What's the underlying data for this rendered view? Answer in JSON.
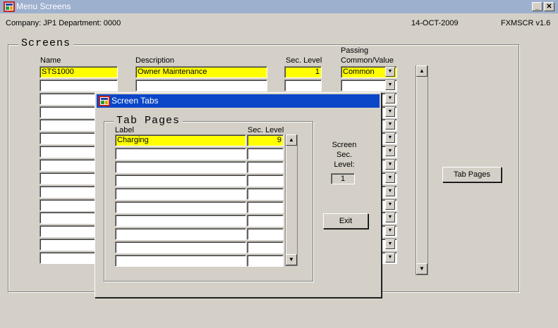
{
  "window": {
    "title": "Menu Screens",
    "minimize_glyph": "_",
    "close_glyph": "✕"
  },
  "info": {
    "company": "Company: JP1   Department: 0000",
    "date": "14-OCT-2009",
    "form": "FXMSCR  v1.6"
  },
  "screens": {
    "title": "Screens",
    "headers": {
      "name": "Name",
      "description": "Description",
      "sec_level": "Sec. Level",
      "passing_line1": "Passing",
      "passing_line2": "Common/Value"
    },
    "rows": [
      {
        "name": "STS1000",
        "description": "Owner Maintenance",
        "sec_level": "1",
        "passing": "Common"
      },
      {
        "name": "",
        "description": "",
        "sec_level": "",
        "passing": ""
      },
      {
        "name": "",
        "description": "",
        "sec_level": "",
        "passing": ""
      },
      {
        "name": "",
        "description": "",
        "sec_level": "",
        "passing": ""
      },
      {
        "name": "",
        "description": "",
        "sec_level": "",
        "passing": ""
      },
      {
        "name": "",
        "description": "",
        "sec_level": "",
        "passing": ""
      },
      {
        "name": "",
        "description": "",
        "sec_level": "",
        "passing": ""
      },
      {
        "name": "",
        "description": "",
        "sec_level": "",
        "passing": ""
      },
      {
        "name": "",
        "description": "",
        "sec_level": "",
        "passing": ""
      },
      {
        "name": "",
        "description": "",
        "sec_level": "",
        "passing": ""
      },
      {
        "name": "",
        "description": "",
        "sec_level": "",
        "passing": ""
      },
      {
        "name": "",
        "description": "",
        "sec_level": "",
        "passing": ""
      },
      {
        "name": "",
        "description": "",
        "sec_level": "",
        "passing": ""
      },
      {
        "name": "",
        "description": "",
        "sec_level": "",
        "passing": ""
      },
      {
        "name": "",
        "description": "",
        "sec_level": "",
        "passing": ""
      }
    ],
    "tab_pages_button": "Tab Pages"
  },
  "dialog": {
    "title": "Screen Tabs",
    "group_title": "Tab Pages",
    "headers": {
      "label": "Label",
      "sec_level": "Sec. Level"
    },
    "rows": [
      {
        "label": "Charging",
        "sec_level": "9"
      },
      {
        "label": "",
        "sec_level": ""
      },
      {
        "label": "",
        "sec_level": ""
      },
      {
        "label": "",
        "sec_level": ""
      },
      {
        "label": "",
        "sec_level": ""
      },
      {
        "label": "",
        "sec_level": ""
      },
      {
        "label": "",
        "sec_level": ""
      },
      {
        "label": "",
        "sec_level": ""
      },
      {
        "label": "",
        "sec_level": ""
      },
      {
        "label": "",
        "sec_level": ""
      }
    ],
    "screen_sec_line1": "Screen",
    "screen_sec_line2": "Sec.",
    "screen_sec_line3": "Level:",
    "screen_sec_value": "1",
    "exit_button": "Exit"
  },
  "icons": {
    "scroll_up": "▲",
    "scroll_down": "▼",
    "dropdown": "▼"
  },
  "colors": {
    "highlight": "#ffff00",
    "inactive_title": "#9db0ce",
    "active_title": "#0a46c8"
  }
}
